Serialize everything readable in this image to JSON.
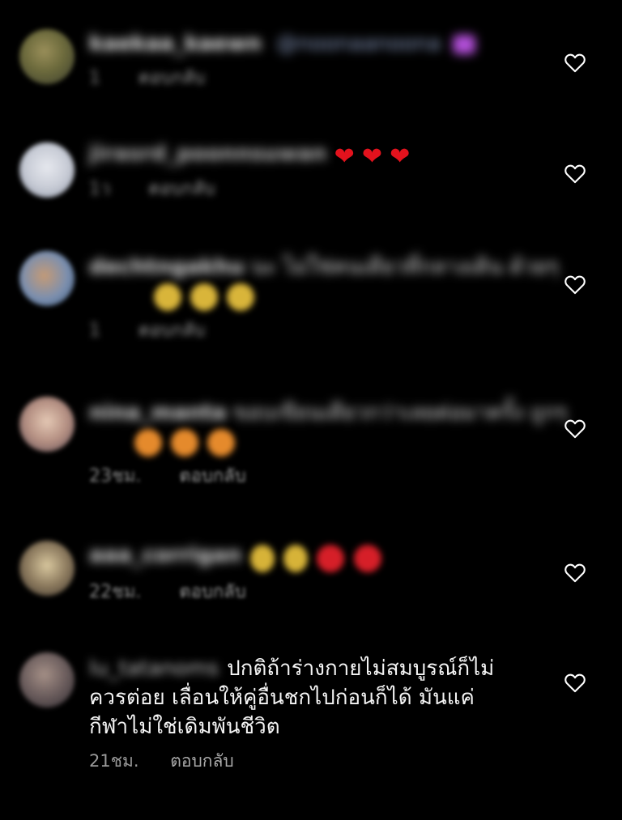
{
  "colors": {
    "background": "#000000",
    "text": "#f4f4f4",
    "meta": "#999999",
    "heart": "#e3121d"
  },
  "comments": [
    {
      "id": 1,
      "username": "kaekaa_kaewn",
      "text": "@noonaanoona",
      "emoji": [
        "purple-gem"
      ],
      "time": "1",
      "reply_label": "ตอบกลับ"
    },
    {
      "id": 2,
      "username": "jirasrd_poonnsuwan",
      "text": "",
      "emoji": [
        "heart",
        "heart",
        "heart"
      ],
      "time": "1ว",
      "reply_label": "ตอบกลับ"
    },
    {
      "id": 3,
      "username": "dechtngakhu",
      "text": "นะ ไม่ใช่คนเดียวที่กลางเดิน ด้วยๆ",
      "emoji": [
        "yellow-face",
        "yellow-face",
        "yellow-face"
      ],
      "time": "1",
      "reply_label": "ตอบกลับ"
    },
    {
      "id": 4,
      "username": "nina_manta",
      "text": "ขอบเขียนเดียวกว่าเลยต่อมาครั้ง ถูกๆ",
      "emoji": [
        "orange-face",
        "orange-face",
        "orange-face"
      ],
      "time": "23ชม.",
      "reply_label": "ตอบกลับ"
    },
    {
      "id": 5,
      "username": "aaa_corrigan",
      "text": "",
      "emoji": [
        "clap",
        "clap",
        "heart",
        "heart"
      ],
      "time": "22ชม.",
      "reply_label": "ตอบกลับ"
    },
    {
      "id": 6,
      "username": "lu_tatanoms",
      "text": "ปกติถ้าร่างกายไม่สมบูรณ์ก็ไม่ควรต่อย เลื่อนให้คู่อื่นชกไปก่อนก็ได้ มันแค่กีฬาไม่ใช่เดิมพันชีวิต",
      "line1": "ปกติถ้าร่างกายไม่สมบูรณ์ก็ไม่",
      "line2": "ควรต่อย เลื่อนให้คู่อื่นชกไปก่อนก็ได้ มันแค่",
      "line3": "กีฬาไม่ใช่เดิมพันชีวิต",
      "time": "21ชม.",
      "reply_label": "ตอบกลับ"
    }
  ],
  "icons": {
    "like": "heart-outline-icon"
  }
}
